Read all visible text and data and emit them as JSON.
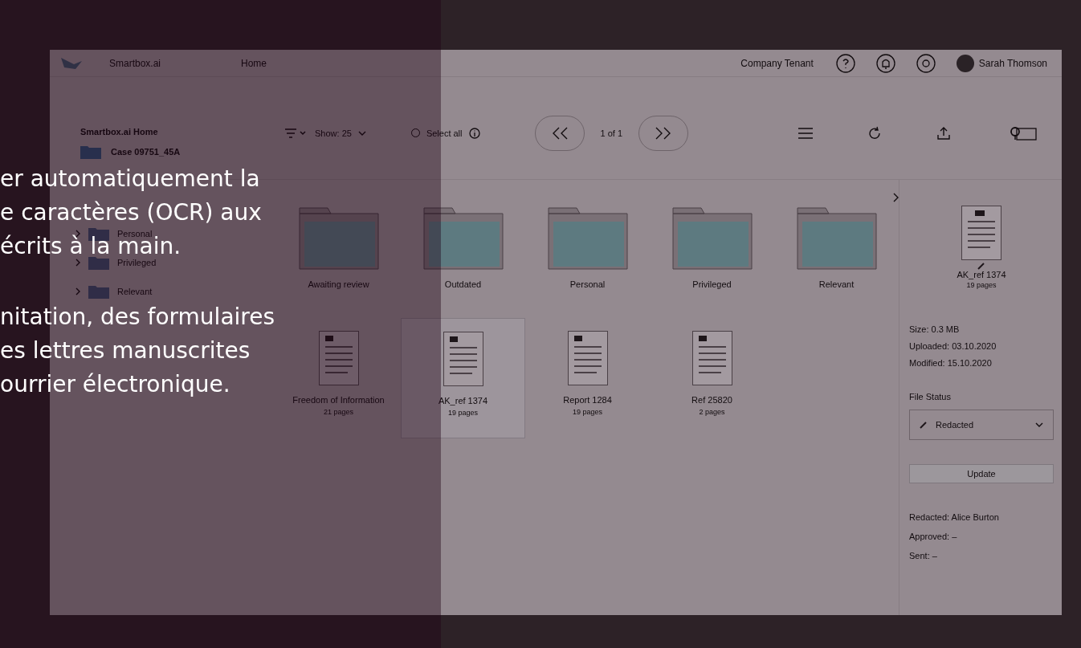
{
  "overlay_text": {
    "paragraphs": [
      [
        "er automatiquement la",
        "e caractères (OCR) aux",
        "écrits à la main."
      ],
      [
        "nitation, des formulaires",
        "es lettres manuscrites",
        "ourrier électronique."
      ]
    ]
  },
  "top_bar": {
    "app_name": "Smartbox.ai",
    "page_title": "Home",
    "tenant": "Company Tenant",
    "user_name": "Sarah Thomson"
  },
  "sidebar": {
    "title": "Smartbox.ai Home",
    "case": "Case 09751_45A",
    "items": [
      {
        "label": "Personal"
      },
      {
        "label": "Privileged"
      },
      {
        "label": "Relevant"
      }
    ]
  },
  "toolbar": {
    "show": "Show: 25",
    "select_all": "Select all",
    "select_all_checked": false,
    "pagination": "1 of 1"
  },
  "items": [
    {
      "kind": "folder",
      "name": "Awaiting review"
    },
    {
      "kind": "folder",
      "name": "Outdated"
    },
    {
      "kind": "folder",
      "name": "Personal"
    },
    {
      "kind": "folder",
      "name": "Privileged"
    },
    {
      "kind": "folder",
      "name": "Relevant"
    },
    {
      "kind": "document",
      "name": "Freedom of Information",
      "pages": "21 pages",
      "selected": false
    },
    {
      "kind": "document",
      "name": "AK_ref 1374",
      "pages": "19 pages",
      "selected": true
    },
    {
      "kind": "document",
      "name": "Report 1284",
      "pages": "19 pages",
      "selected": false
    },
    {
      "kind": "document",
      "name": "Ref 25820",
      "pages": "2 pages",
      "selected": false
    }
  ],
  "details": {
    "name": "AK_ref 1374",
    "pages": "19 pages",
    "meta": [
      "Size: 0.3 MB",
      "Uploaded: 03.10.2020",
      "Modified: 15.10.2020"
    ],
    "status_label": "File Status",
    "status_value": "Redacted",
    "update_button": "Update",
    "history": [
      "Redacted: Alice Burton",
      "Approved: –",
      "Sent: –"
    ]
  }
}
